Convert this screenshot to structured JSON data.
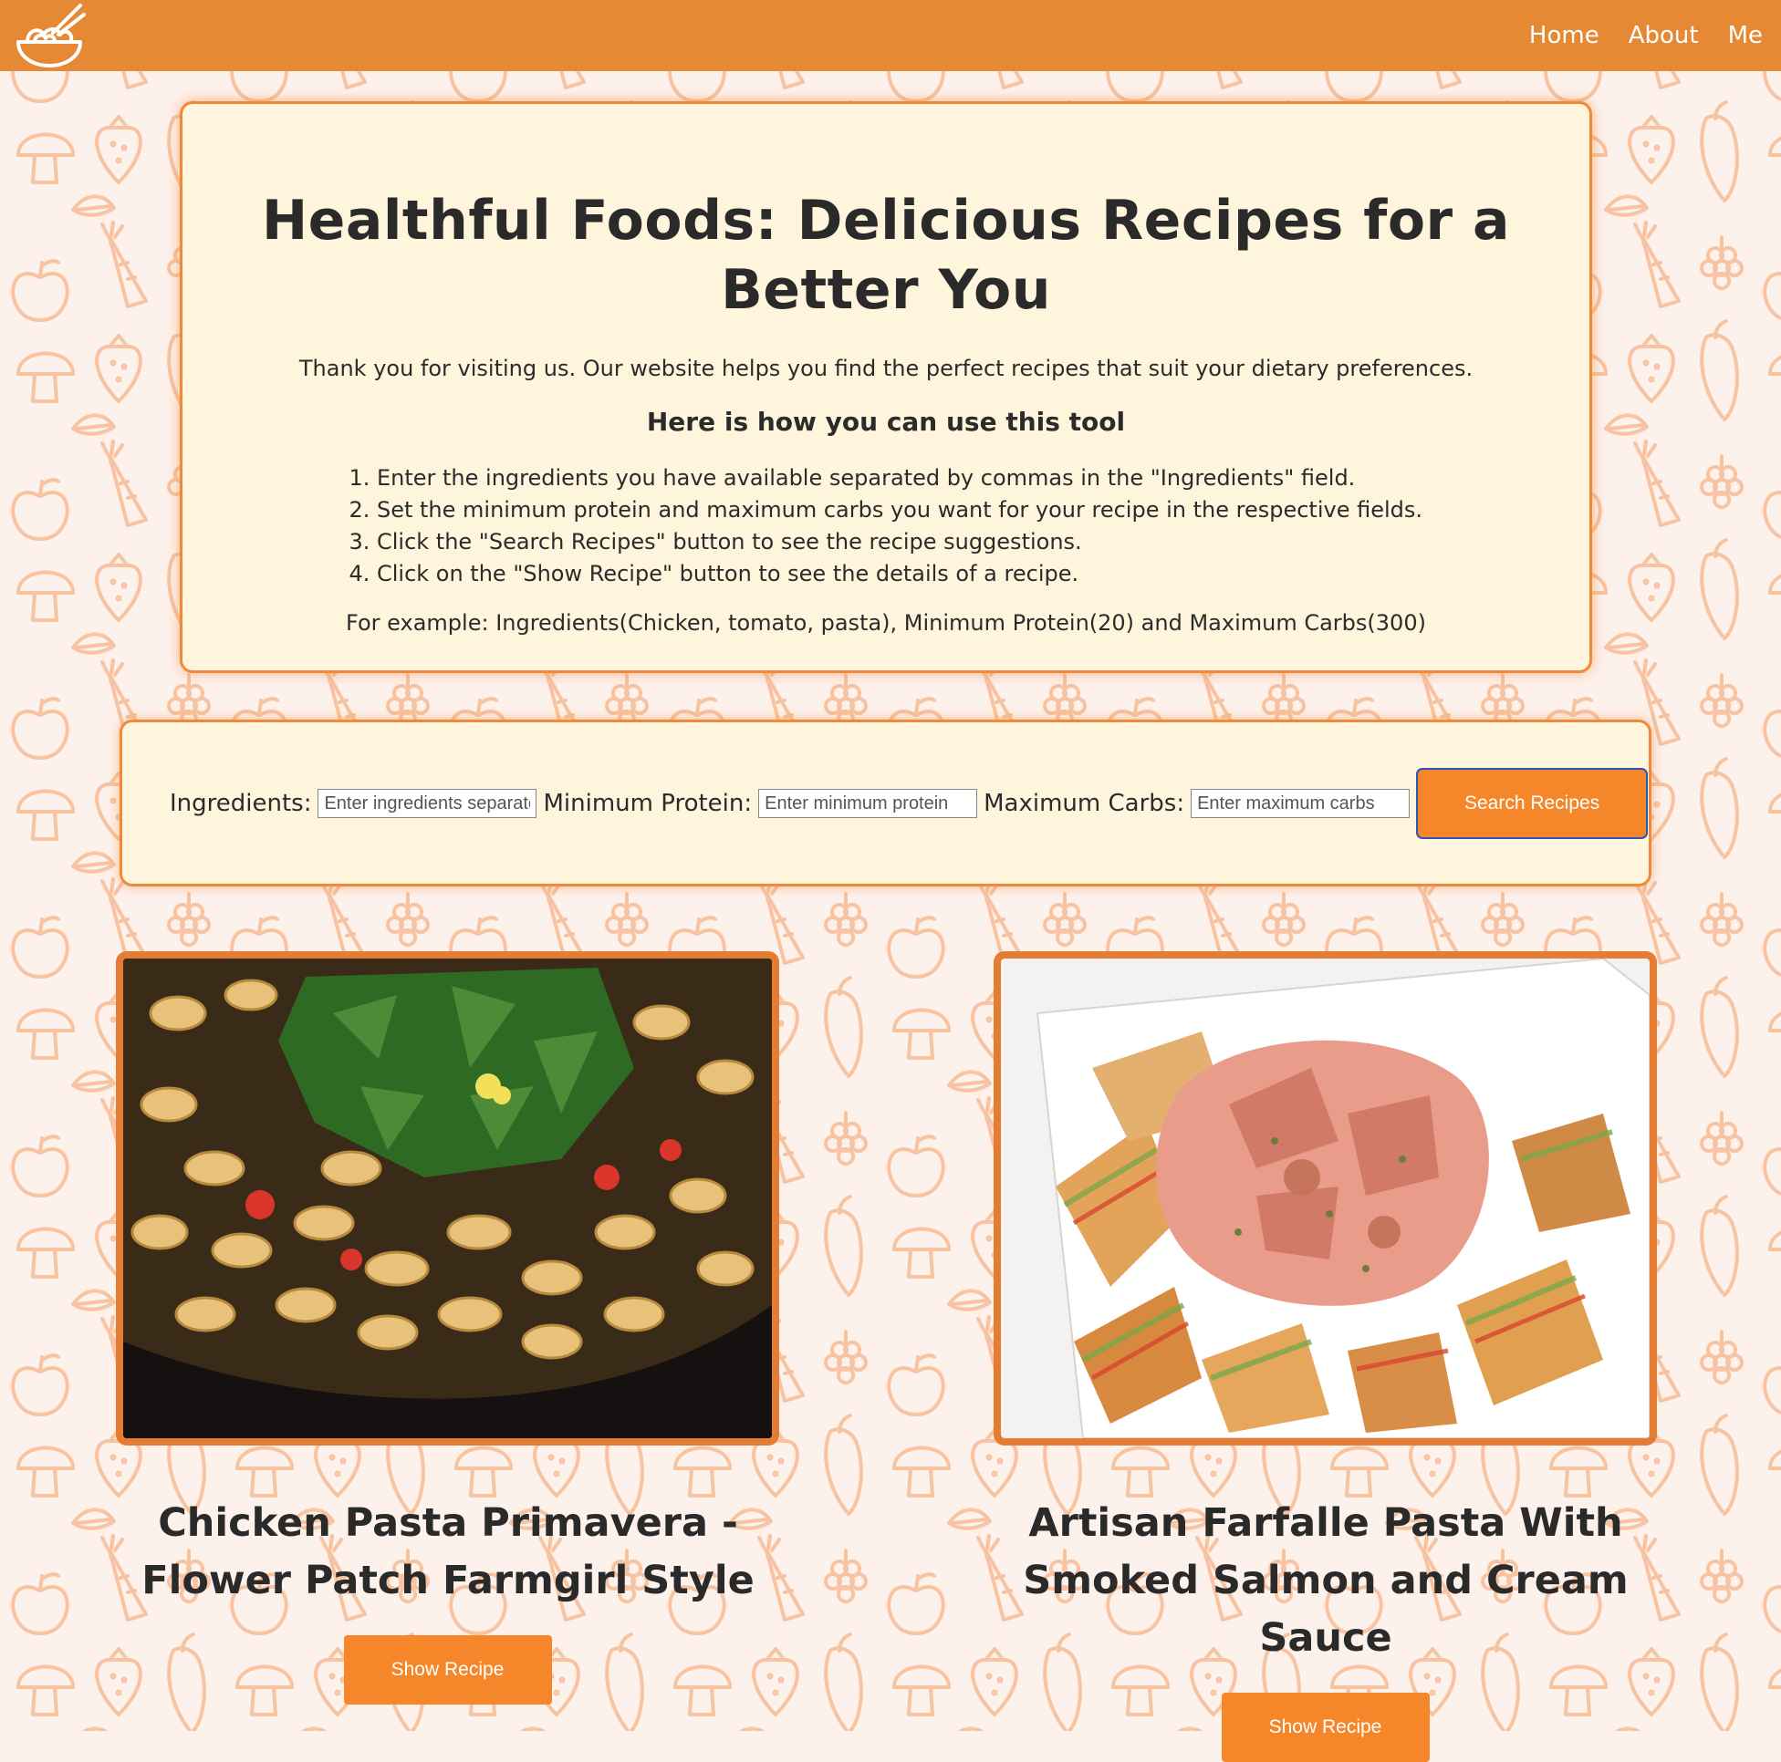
{
  "nav": {
    "logo_icon": "noodle-bowl-icon",
    "links": [
      "Home",
      "About",
      "Me"
    ]
  },
  "intro": {
    "title": "Healthful Foods: Delicious Recipes for a Better You",
    "description": "Thank you for visiting us. Our website helps you find the perfect recipes that suit your dietary preferences.",
    "subheading": "Here is how you can use this tool",
    "steps": [
      "Enter the ingredients you have available separated by commas in the \"Ingredients\" field.",
      "Set the minimum protein and maximum carbs you want for your recipe in the respective fields.",
      "Click the \"Search Recipes\" button to see the recipe suggestions.",
      "Click on the \"Show Recipe\" button to see the details of a recipe."
    ],
    "example": "For example: Ingredients(Chicken, tomato, pasta), Minimum Protein(20) and Maximum Carbs(300)"
  },
  "search": {
    "ingredients_label": "Ingredients:",
    "ingredients_placeholder": "Enter ingredients separated by commas",
    "protein_label": "Minimum Protein:",
    "protein_placeholder": "Enter minimum protein",
    "carbs_label": "Maximum Carbs:",
    "carbs_placeholder": "Enter maximum carbs",
    "button_label": "Search Recipes"
  },
  "recipes": [
    {
      "title": "Chicken Pasta Primavera - Flower Patch Farmgirl Style",
      "button_label": "Show Recipe"
    },
    {
      "title": "Artisan Farfalle Pasta With Smoked Salmon and Cream Sauce",
      "button_label": "Show Recipe"
    }
  ],
  "colors": {
    "nav_bg": "#e68934",
    "card_bg": "#fff5dc",
    "card_border": "#f08a3a",
    "button_bg": "#f5872a",
    "page_bg": "#fdf1ec",
    "doodle": "#f7c6a3"
  }
}
